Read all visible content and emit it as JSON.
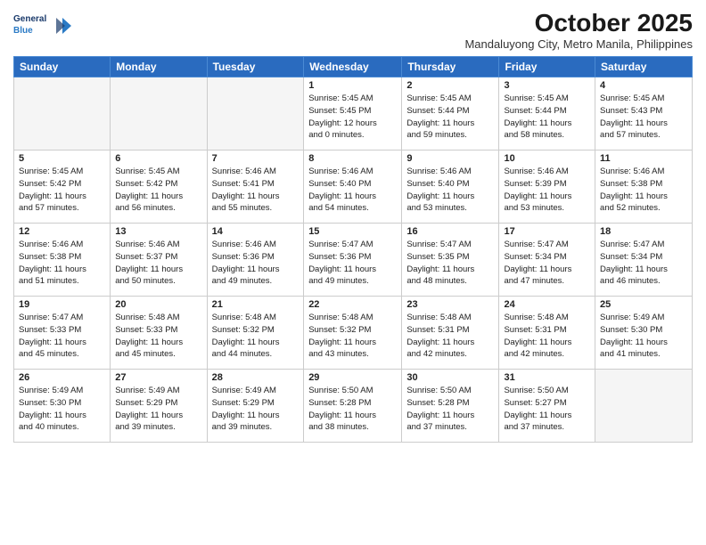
{
  "header": {
    "logo_line1": "General",
    "logo_line2": "Blue",
    "month": "October 2025",
    "location": "Mandaluyong City, Metro Manila, Philippines"
  },
  "weekdays": [
    "Sunday",
    "Monday",
    "Tuesday",
    "Wednesday",
    "Thursday",
    "Friday",
    "Saturday"
  ],
  "weeks": [
    [
      {
        "day": "",
        "info": ""
      },
      {
        "day": "",
        "info": ""
      },
      {
        "day": "",
        "info": ""
      },
      {
        "day": "1",
        "info": "Sunrise: 5:45 AM\nSunset: 5:45 PM\nDaylight: 12 hours\nand 0 minutes."
      },
      {
        "day": "2",
        "info": "Sunrise: 5:45 AM\nSunset: 5:44 PM\nDaylight: 11 hours\nand 59 minutes."
      },
      {
        "day": "3",
        "info": "Sunrise: 5:45 AM\nSunset: 5:44 PM\nDaylight: 11 hours\nand 58 minutes."
      },
      {
        "day": "4",
        "info": "Sunrise: 5:45 AM\nSunset: 5:43 PM\nDaylight: 11 hours\nand 57 minutes."
      }
    ],
    [
      {
        "day": "5",
        "info": "Sunrise: 5:45 AM\nSunset: 5:42 PM\nDaylight: 11 hours\nand 57 minutes."
      },
      {
        "day": "6",
        "info": "Sunrise: 5:45 AM\nSunset: 5:42 PM\nDaylight: 11 hours\nand 56 minutes."
      },
      {
        "day": "7",
        "info": "Sunrise: 5:46 AM\nSunset: 5:41 PM\nDaylight: 11 hours\nand 55 minutes."
      },
      {
        "day": "8",
        "info": "Sunrise: 5:46 AM\nSunset: 5:40 PM\nDaylight: 11 hours\nand 54 minutes."
      },
      {
        "day": "9",
        "info": "Sunrise: 5:46 AM\nSunset: 5:40 PM\nDaylight: 11 hours\nand 53 minutes."
      },
      {
        "day": "10",
        "info": "Sunrise: 5:46 AM\nSunset: 5:39 PM\nDaylight: 11 hours\nand 53 minutes."
      },
      {
        "day": "11",
        "info": "Sunrise: 5:46 AM\nSunset: 5:38 PM\nDaylight: 11 hours\nand 52 minutes."
      }
    ],
    [
      {
        "day": "12",
        "info": "Sunrise: 5:46 AM\nSunset: 5:38 PM\nDaylight: 11 hours\nand 51 minutes."
      },
      {
        "day": "13",
        "info": "Sunrise: 5:46 AM\nSunset: 5:37 PM\nDaylight: 11 hours\nand 50 minutes."
      },
      {
        "day": "14",
        "info": "Sunrise: 5:46 AM\nSunset: 5:36 PM\nDaylight: 11 hours\nand 49 minutes."
      },
      {
        "day": "15",
        "info": "Sunrise: 5:47 AM\nSunset: 5:36 PM\nDaylight: 11 hours\nand 49 minutes."
      },
      {
        "day": "16",
        "info": "Sunrise: 5:47 AM\nSunset: 5:35 PM\nDaylight: 11 hours\nand 48 minutes."
      },
      {
        "day": "17",
        "info": "Sunrise: 5:47 AM\nSunset: 5:34 PM\nDaylight: 11 hours\nand 47 minutes."
      },
      {
        "day": "18",
        "info": "Sunrise: 5:47 AM\nSunset: 5:34 PM\nDaylight: 11 hours\nand 46 minutes."
      }
    ],
    [
      {
        "day": "19",
        "info": "Sunrise: 5:47 AM\nSunset: 5:33 PM\nDaylight: 11 hours\nand 45 minutes."
      },
      {
        "day": "20",
        "info": "Sunrise: 5:48 AM\nSunset: 5:33 PM\nDaylight: 11 hours\nand 45 minutes."
      },
      {
        "day": "21",
        "info": "Sunrise: 5:48 AM\nSunset: 5:32 PM\nDaylight: 11 hours\nand 44 minutes."
      },
      {
        "day": "22",
        "info": "Sunrise: 5:48 AM\nSunset: 5:32 PM\nDaylight: 11 hours\nand 43 minutes."
      },
      {
        "day": "23",
        "info": "Sunrise: 5:48 AM\nSunset: 5:31 PM\nDaylight: 11 hours\nand 42 minutes."
      },
      {
        "day": "24",
        "info": "Sunrise: 5:48 AM\nSunset: 5:31 PM\nDaylight: 11 hours\nand 42 minutes."
      },
      {
        "day": "25",
        "info": "Sunrise: 5:49 AM\nSunset: 5:30 PM\nDaylight: 11 hours\nand 41 minutes."
      }
    ],
    [
      {
        "day": "26",
        "info": "Sunrise: 5:49 AM\nSunset: 5:30 PM\nDaylight: 11 hours\nand 40 minutes."
      },
      {
        "day": "27",
        "info": "Sunrise: 5:49 AM\nSunset: 5:29 PM\nDaylight: 11 hours\nand 39 minutes."
      },
      {
        "day": "28",
        "info": "Sunrise: 5:49 AM\nSunset: 5:29 PM\nDaylight: 11 hours\nand 39 minutes."
      },
      {
        "day": "29",
        "info": "Sunrise: 5:50 AM\nSunset: 5:28 PM\nDaylight: 11 hours\nand 38 minutes."
      },
      {
        "day": "30",
        "info": "Sunrise: 5:50 AM\nSunset: 5:28 PM\nDaylight: 11 hours\nand 37 minutes."
      },
      {
        "day": "31",
        "info": "Sunrise: 5:50 AM\nSunset: 5:27 PM\nDaylight: 11 hours\nand 37 minutes."
      },
      {
        "day": "",
        "info": ""
      }
    ]
  ]
}
